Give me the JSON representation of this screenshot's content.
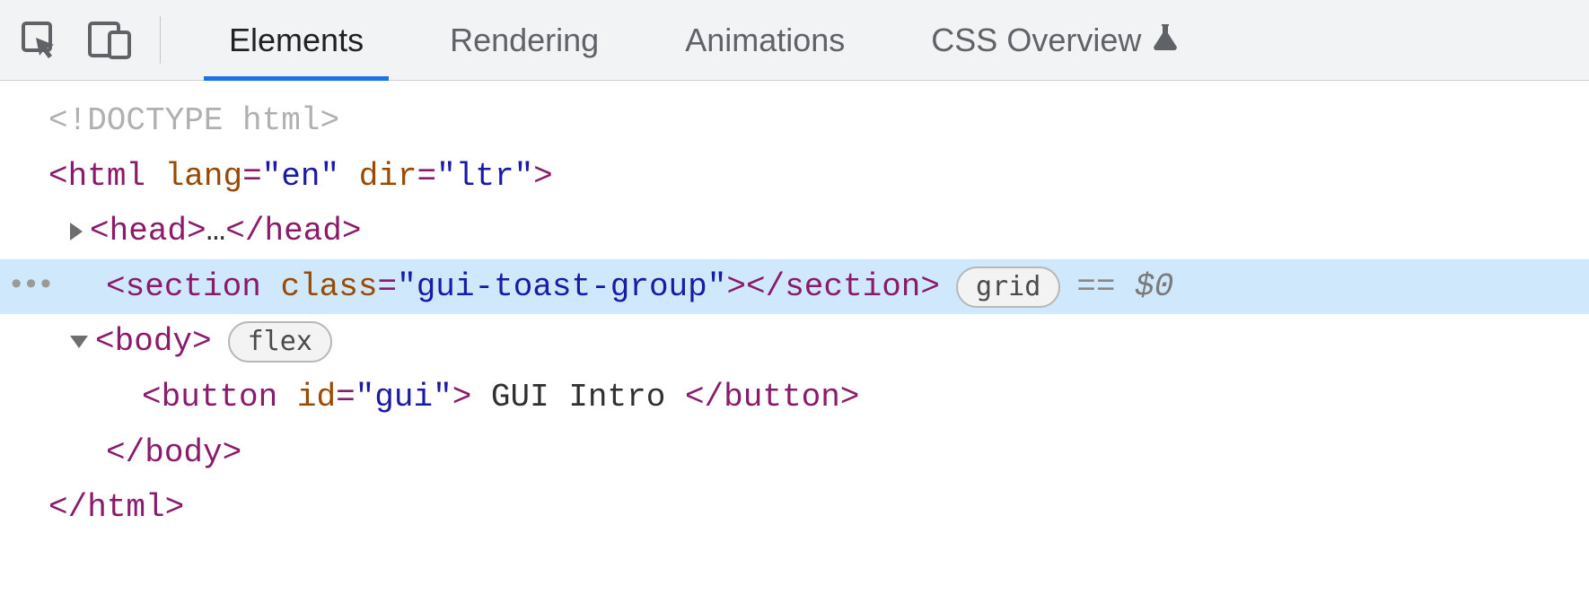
{
  "toolbar": {
    "tabs": [
      {
        "label": "Elements",
        "active": true
      },
      {
        "label": "Rendering",
        "active": false
      },
      {
        "label": "Animations",
        "active": false
      },
      {
        "label": "CSS Overview",
        "active": false,
        "experiment": true
      }
    ]
  },
  "tree": {
    "doctype": "<!DOCTYPE html>",
    "html_open": {
      "tag": "html",
      "attrs": [
        {
          "name": "lang",
          "value": "en"
        },
        {
          "name": "dir",
          "value": "ltr"
        }
      ]
    },
    "head": {
      "tag": "head",
      "collapsed_content": "…"
    },
    "section_selected": {
      "tag": "section",
      "attrs": [
        {
          "name": "class",
          "value": "gui-toast-group"
        }
      ],
      "layout_badge": "grid",
      "console_ref_prefix": "==",
      "console_ref": "$0"
    },
    "body": {
      "tag": "body",
      "layout_badge": "flex"
    },
    "button": {
      "tag": "button",
      "attrs": [
        {
          "name": "id",
          "value": "gui"
        }
      ],
      "text": " GUI Intro "
    },
    "body_close": "body",
    "html_close": "html"
  }
}
